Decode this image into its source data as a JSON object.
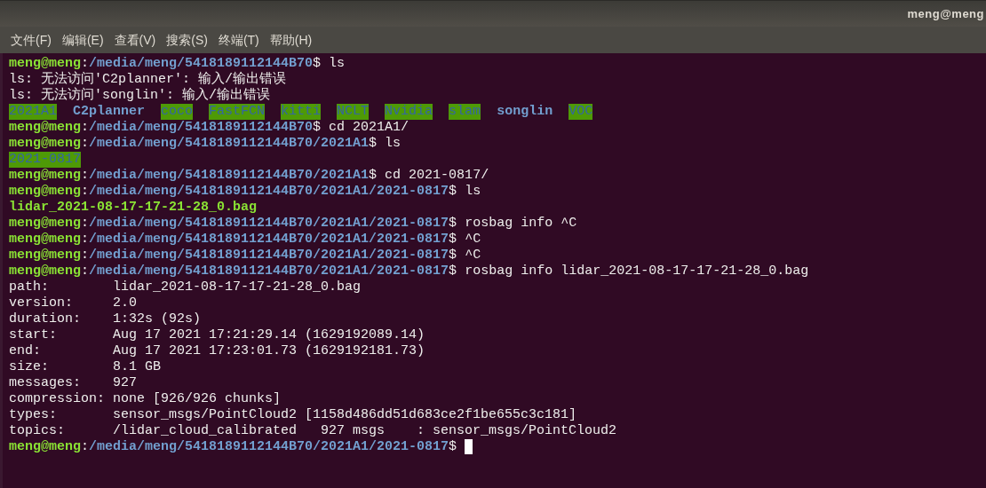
{
  "window": {
    "title": "meng@meng"
  },
  "menu": [
    {
      "label": "文件(F)"
    },
    {
      "label": "编辑(E)"
    },
    {
      "label": "查看(V)"
    },
    {
      "label": "搜索(S)"
    },
    {
      "label": "终端(T)"
    },
    {
      "label": "帮助(H)"
    }
  ],
  "lines": [
    {
      "kind": "prompt",
      "user": "meng@meng",
      "sep": ":",
      "path": "/media/meng/5418189112144B70",
      "end": "$",
      "command": "ls"
    },
    {
      "kind": "output",
      "text": "ls: 无法访问'C2planner': 输入/输出错误"
    },
    {
      "kind": "output",
      "text": "ls: 无法访问'songlin': 输入/输出错误"
    },
    {
      "kind": "listing",
      "entries": [
        {
          "name": "2021A1",
          "highlighted": true
        },
        {
          "name": "C2planner",
          "highlighted": false
        },
        {
          "name": "coco",
          "highlighted": true
        },
        {
          "name": "FastFCN",
          "highlighted": true
        },
        {
          "name": "kitti",
          "highlighted": true
        },
        {
          "name": "NCLT",
          "highlighted": true
        },
        {
          "name": "Nvidia",
          "highlighted": true
        },
        {
          "name": "slam",
          "highlighted": true
        },
        {
          "name": "songlin",
          "highlighted": false
        },
        {
          "name": "VOC",
          "highlighted": true
        }
      ]
    },
    {
      "kind": "prompt",
      "user": "meng@meng",
      "sep": ":",
      "path": "/media/meng/5418189112144B70",
      "end": "$",
      "command": "cd 2021A1/"
    },
    {
      "kind": "prompt",
      "user": "meng@meng",
      "sep": ":",
      "path": "/media/meng/5418189112144B70/2021A1",
      "end": "$",
      "command": "ls"
    },
    {
      "kind": "listing",
      "entries": [
        {
          "name": "2021-0817",
          "highlighted": true
        }
      ]
    },
    {
      "kind": "prompt",
      "user": "meng@meng",
      "sep": ":",
      "path": "/media/meng/5418189112144B70/2021A1",
      "end": "$",
      "command": "cd 2021-0817/"
    },
    {
      "kind": "prompt",
      "user": "meng@meng",
      "sep": ":",
      "path": "/media/meng/5418189112144B70/2021A1/2021-0817",
      "end": "$",
      "command": "ls"
    },
    {
      "kind": "file",
      "text": "lidar_2021-08-17-17-21-28_0.bag"
    },
    {
      "kind": "prompt",
      "user": "meng@meng",
      "sep": ":",
      "path": "/media/meng/5418189112144B70/2021A1/2021-0817",
      "end": "$",
      "command": "rosbag info ^C"
    },
    {
      "kind": "prompt",
      "user": "meng@meng",
      "sep": ":",
      "path": "/media/meng/5418189112144B70/2021A1/2021-0817",
      "end": "$",
      "command": "^C"
    },
    {
      "kind": "prompt",
      "user": "meng@meng",
      "sep": ":",
      "path": "/media/meng/5418189112144B70/2021A1/2021-0817",
      "end": "$",
      "command": "^C"
    },
    {
      "kind": "prompt",
      "user": "meng@meng",
      "sep": ":",
      "path": "/media/meng/5418189112144B70/2021A1/2021-0817",
      "end": "$",
      "command": "rosbag info lidar_2021-08-17-17-21-28_0.bag"
    },
    {
      "kind": "output",
      "text": "path:        lidar_2021-08-17-17-21-28_0.bag"
    },
    {
      "kind": "output",
      "text": "version:     2.0"
    },
    {
      "kind": "output",
      "text": "duration:    1:32s (92s)"
    },
    {
      "kind": "output",
      "text": "start:       Aug 17 2021 17:21:29.14 (1629192089.14)"
    },
    {
      "kind": "output",
      "text": "end:         Aug 17 2021 17:23:01.73 (1629192181.73)"
    },
    {
      "kind": "output",
      "text": "size:        8.1 GB"
    },
    {
      "kind": "output",
      "text": "messages:    927"
    },
    {
      "kind": "output",
      "text": "compression: none [926/926 chunks]"
    },
    {
      "kind": "output",
      "text": "types:       sensor_msgs/PointCloud2 [1158d486dd51d683ce2f1be655c3c181]"
    },
    {
      "kind": "output",
      "text": "topics:      /lidar_cloud_calibrated   927 msgs    : sensor_msgs/PointCloud2"
    },
    {
      "kind": "prompt",
      "user": "meng@meng",
      "sep": ":",
      "path": "/media/meng/5418189112144B70/2021A1/2021-0817",
      "end": "$",
      "cursor": true
    }
  ]
}
